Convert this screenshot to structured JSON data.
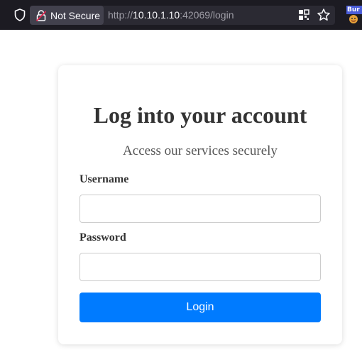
{
  "browser": {
    "security_label": "Not Secure",
    "url_scheme": "http://",
    "url_host": "10.10.1.10",
    "url_rest": ":42069/login",
    "extension_label": "Bur",
    "icons": [
      "shield-icon",
      "lock-icon",
      "qr-icon",
      "star-icon",
      "burp-extension-icon"
    ]
  },
  "login_card": {
    "title": "Log into your account",
    "subtitle": "Access our services securely",
    "username_label": "Username",
    "username_value": "",
    "password_label": "Password",
    "password_value": "",
    "login_button": "Login"
  },
  "colors": {
    "toolbar_bg": "#1c1b22",
    "urlbar_bg": "#2b2a33",
    "button_primary": "#007bff",
    "title_text": "#333333"
  }
}
